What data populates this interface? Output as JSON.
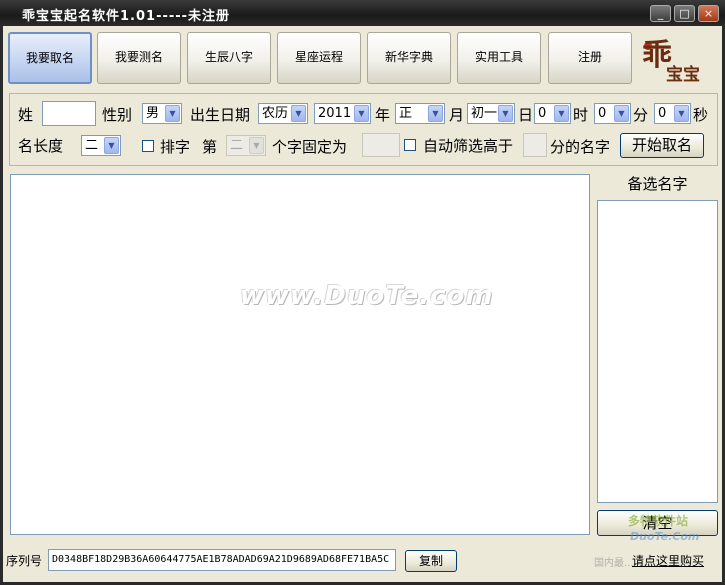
{
  "window": {
    "title": "乖宝宝起名软件1.01-----未注册",
    "minimize": "_",
    "maximize": "□",
    "close": "×"
  },
  "toolbar": {
    "items": [
      {
        "label": "我要取名",
        "active": true
      },
      {
        "label": "我要测名"
      },
      {
        "label": "生辰八字"
      },
      {
        "label": "星座运程"
      },
      {
        "label": "新华字典"
      },
      {
        "label": "实用工具"
      },
      {
        "label": "注册"
      }
    ]
  },
  "logo": {
    "text_main": "乖",
    "text_sub": "宝宝"
  },
  "form": {
    "surname_label": "姓",
    "surname_value": "",
    "gender_label": "性别",
    "gender_value": "男",
    "birthdate_label": "出生日期",
    "calendar_value": "农历",
    "year_value": "2011",
    "year_label": "年",
    "month_value": "正",
    "month_label": "月",
    "day_value": "初一",
    "day_label": "日",
    "hour_value": "0",
    "hour_label": "时",
    "minute_value": "0",
    "minute_label": "分",
    "second_value": "0",
    "second_label": "秒",
    "namelength_label": "名长度",
    "namelength_value": "二",
    "paizi_label": "排字",
    "di_label": "第",
    "position_value": "二",
    "fixed_label": "个字固定为",
    "fixed_value": "",
    "autofilter_label": "自动筛选高于",
    "score_value": "",
    "score_suffix": "分的名字",
    "start_button": "开始取名"
  },
  "main": {
    "watermark": "www.DuoTe.com"
  },
  "candidates": {
    "header": "备选名字",
    "clear_button": "清空"
  },
  "status": {
    "serial_label": "序列号",
    "serial_value": "D0348BF18D29B36A60644775AE1B78ADAD69A21D9689AD68FE71BA5C",
    "copy_button": "复制",
    "purchase_link": "请点这里购买"
  },
  "site_watermark": {
    "line1": "多特软件站",
    "line2": "DuoTe.Com",
    "line3": "国内最..."
  }
}
